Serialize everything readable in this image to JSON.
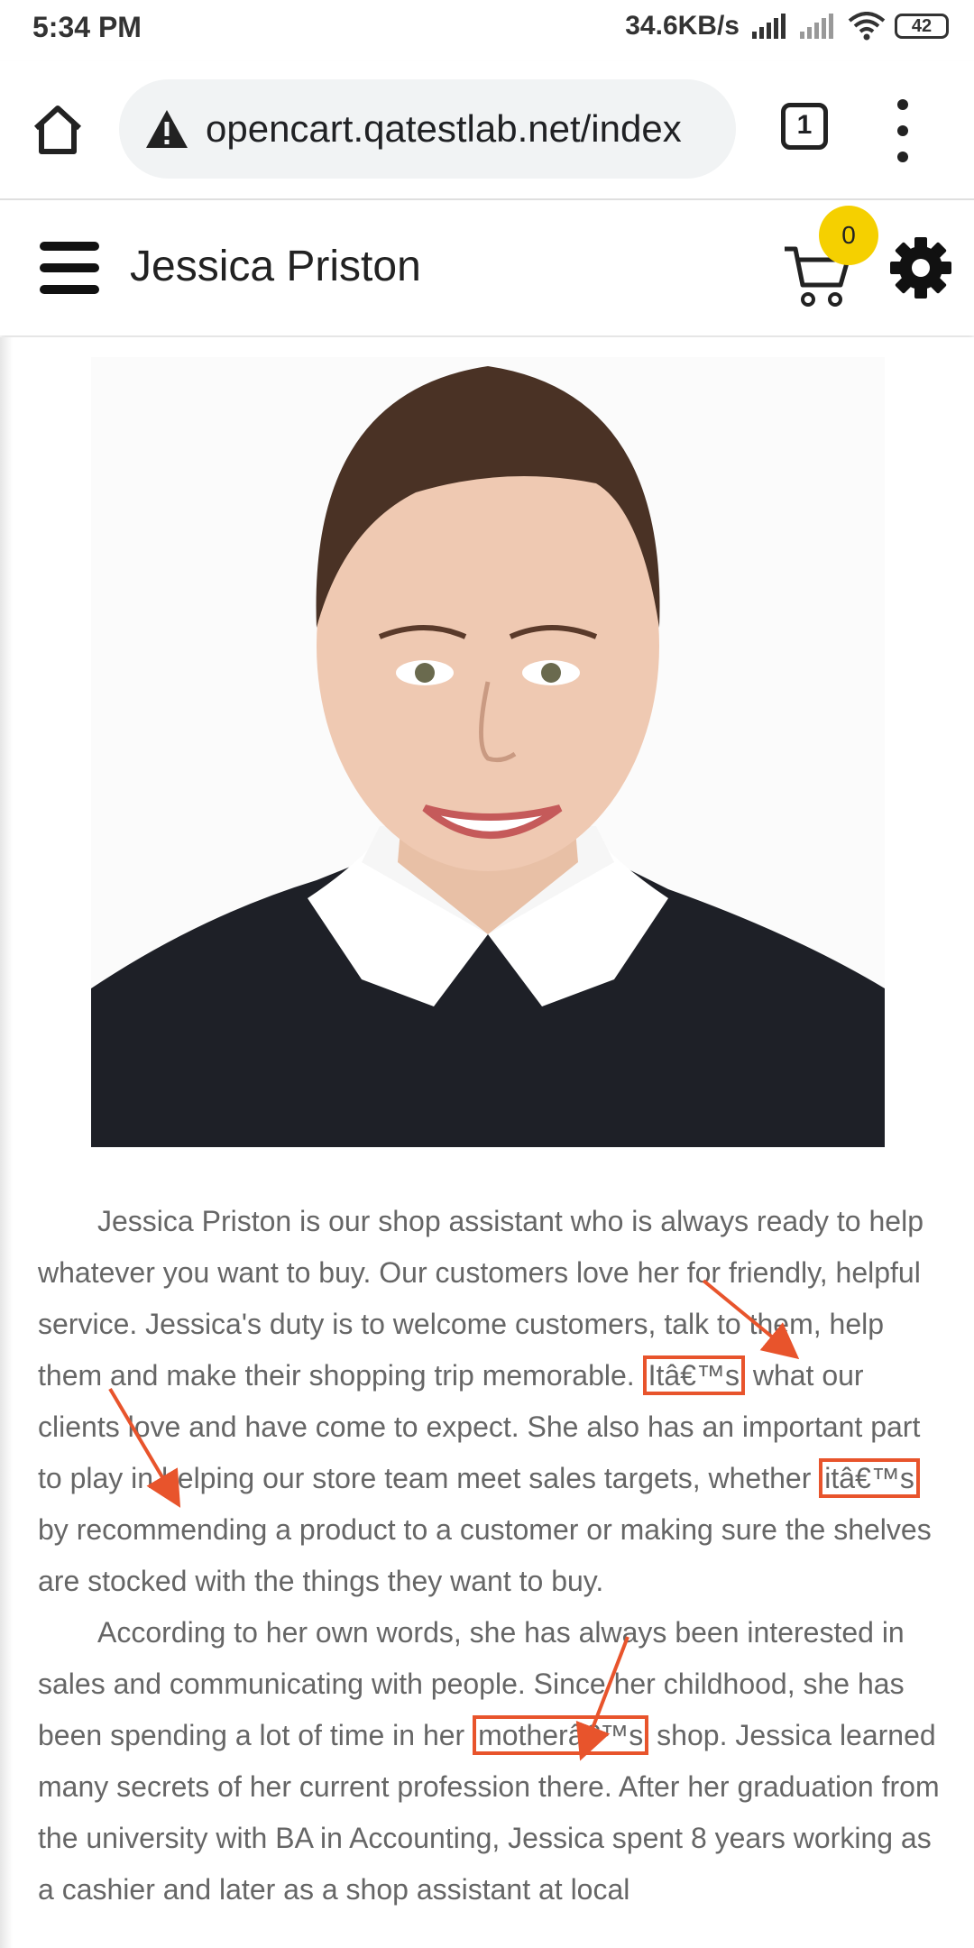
{
  "status_bar": {
    "time": "5:34 PM",
    "net_speed": "34.6KB/s",
    "battery": "42"
  },
  "browser": {
    "url": "opencart.qatestlab.net/index",
    "tab_count": "1"
  },
  "site": {
    "title": "Jessica Priston",
    "cart_count": "0"
  },
  "article": {
    "p1_a": "Jessica Priston is our shop assistant who is always ready to help whatever you want to buy. Our customers love her for friendly, helpful service. Jessica's duty is to welcome customers, talk to them, help them and make their shopping trip memorable. ",
    "p1_hl1": "Itâ€™s",
    "p1_b": " what our clients love and have come to expect. She also has an important part to play in helping our store team meet sales targets, whether ",
    "p1_hl2": "itâ€™s",
    "p1_c": " by recommending a product to a customer or making sure the shelves are stocked with the things they want to buy.",
    "p2_a": "According to her own words, she has always been interested in sales and communicating with people. Since her childhood, she has been spending a lot of time in her ",
    "p2_hl": "motherâ€™s",
    "p2_b": " shop. Jessica learned many secrets of her current profession there. After her graduation from the university with BA in Accounting, Jessica spent 8 years working as a cashier and later as a shop assistant at local"
  },
  "colors": {
    "highlight": "#e8542c",
    "badge": "#f5d000"
  }
}
